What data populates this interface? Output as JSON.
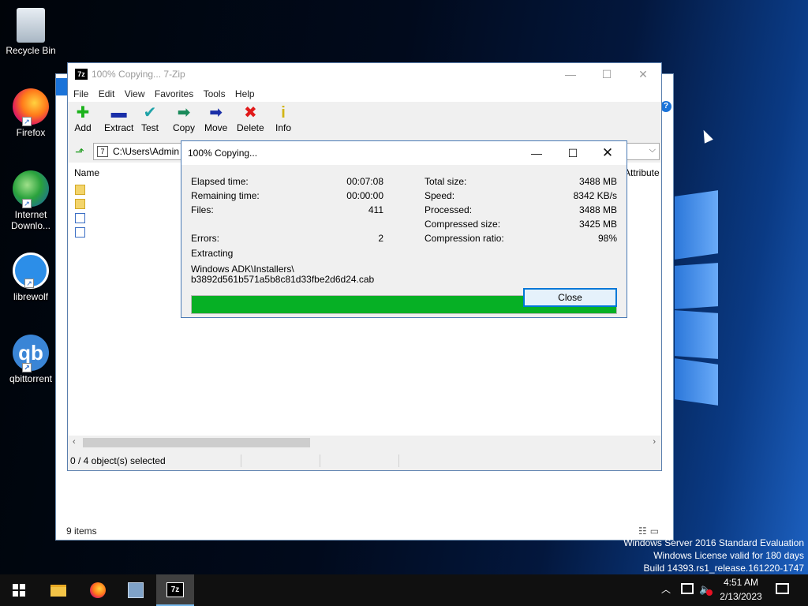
{
  "desktop": {
    "icons": [
      {
        "label": "Recycle Bin"
      },
      {
        "label": "Firefox"
      },
      {
        "label": "Internet Downlo..."
      },
      {
        "label": "librewolf"
      },
      {
        "label": "qbittorrent",
        "glyph": "qb"
      }
    ],
    "watermark": {
      "line1": "Windows Server 2016 Standard Evaluation",
      "line2": "Windows License valid for 180 days",
      "line3": "Build 14393.rs1_release.161220-1747"
    }
  },
  "background_window": {
    "status_items": "9 items"
  },
  "zip_window": {
    "title": "100% Copying... 7-Zip",
    "logo": "7z",
    "menu": [
      "File",
      "Edit",
      "View",
      "Favorites",
      "Tools",
      "Help"
    ],
    "toolbar": {
      "add": {
        "label": "Add",
        "icon": "plus-icon",
        "glyph": "✚"
      },
      "extract": {
        "label": "Extract",
        "icon": "minus-icon",
        "glyph": "▬"
      },
      "test": {
        "label": "Test",
        "icon": "checkmark-icon",
        "glyph": "✔"
      },
      "copy": {
        "label": "Copy",
        "icon": "copy-arrow-icon",
        "glyph": "➡"
      },
      "move": {
        "label": "Move",
        "icon": "move-arrow-icon",
        "glyph": "➡"
      },
      "delete": {
        "label": "Delete",
        "icon": "delete-x-icon",
        "glyph": "✖"
      },
      "info": {
        "label": "Info",
        "icon": "info-icon",
        "glyph": "i"
      }
    },
    "address": {
      "path": "C:\\Users\\Admin"
    },
    "columns": {
      "name": "Name",
      "attributes": "Attribute"
    },
    "status": {
      "selected": "0 / 4 object(s) selected"
    }
  },
  "progress_dialog": {
    "title": "100% Copying...",
    "left": [
      {
        "label": "Elapsed time:",
        "value": "00:07:08"
      },
      {
        "label": "Remaining time:",
        "value": "00:00:00"
      },
      {
        "label": "Files:",
        "value": "411"
      },
      {
        "label": "Errors:",
        "value": "2"
      }
    ],
    "right": [
      {
        "label": "Total size:",
        "value": "3488 MB"
      },
      {
        "label": "Speed:",
        "value": "8342 KB/s"
      },
      {
        "label": "Processed:",
        "value": "3488 MB"
      },
      {
        "label": "Compressed size:",
        "value": "3425 MB"
      },
      {
        "label": "Compression ratio:",
        "value": "98%"
      }
    ],
    "operation": "Extracting",
    "current_path_line1": "Windows ADK\\Installers\\",
    "current_path_line2": "b3892d561b571a5b8c81d33fbe2d6d24.cab",
    "progress": 1.0,
    "close_button": "Close"
  },
  "taskbar": {
    "time": "4:51 AM",
    "date": "2/13/2023",
    "zip_glyph": "7z"
  },
  "colors": {
    "progress_fill": "#06b025",
    "accent": "#0078d7"
  }
}
